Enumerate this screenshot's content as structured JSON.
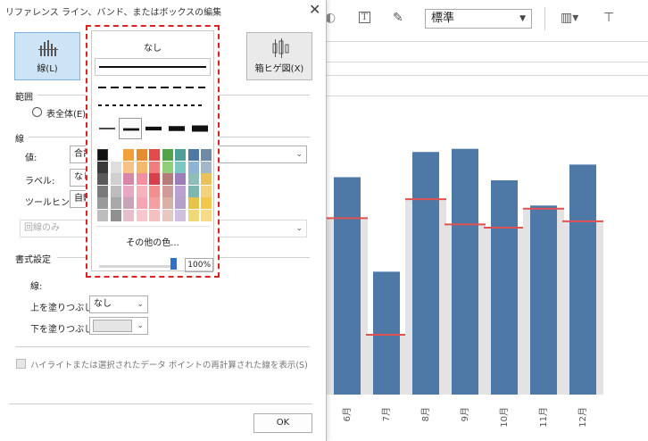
{
  "dialog": {
    "title": "リファレンス ライン、バンド、またはボックスの編集",
    "close_glyph": "✕",
    "type_buttons": [
      {
        "label": "線(L)",
        "selected": true
      },
      {
        "label": "箱ヒゲ図(X)",
        "selected": false
      }
    ],
    "range": {
      "section_title": "範囲",
      "option_label": "表全体(E)"
    },
    "line_section": {
      "title": "線",
      "value_label": "値:",
      "value_text": "合計",
      "label_label": "ラベル:",
      "label_value": "なし",
      "tooltip_label": "ツールヒント:",
      "tooltip_value": "自動",
      "line_only_text": "回線のみ"
    },
    "format_section": {
      "title": "書式設定",
      "line_label": "線:",
      "fill_above_label": "上を塗りつぶし:",
      "fill_above_value": "なし",
      "fill_below_label": "下を塗りつぶし:"
    },
    "highlight_checkbox_label": "ハイライトまたは選択されたデータ ポイントの再計算された線を表示(S)",
    "ok_label": "OK"
  },
  "popup": {
    "none_label": "なし",
    "more_colors_label": "その他の色...",
    "opacity_text": "100%",
    "opacity_percent": 100,
    "selected_weight_index": 1,
    "palette_columns": [
      [
        "#111111",
        "#3a3a3a",
        "#5a5a5a",
        "#7a7a7a",
        "#9a9a9a",
        "#bdbdbd"
      ],
      [
        "#ffffff",
        "#dedede",
        "#cfcfcf",
        "#bdbdbd",
        "#a8a8a8",
        "#909090"
      ],
      [
        "#f2a13a",
        "#f6c285",
        "#d987a6",
        "#e7a9c2",
        "#c9a4b8",
        "#e6bfcc"
      ],
      [
        "#e48d2c",
        "#f3b96b",
        "#f28fa1",
        "#f6b2bd",
        "#f4a6b4",
        "#f7c7cf"
      ],
      [
        "#e54a4a",
        "#f07d7d",
        "#d6404d",
        "#f28e8e",
        "#f4a0a0",
        "#f7c0c0"
      ],
      [
        "#55a24a",
        "#8fcf7c",
        "#b67b7b",
        "#cf9a9a",
        "#d9b0a6",
        "#e6c8c0"
      ],
      [
        "#4e9e9a",
        "#7cc7c2",
        "#9a7eb5",
        "#b9a2cf",
        "#b5a0c9",
        "#cfc0de"
      ],
      [
        "#4e79a7",
        "#8fb3d6",
        "#8cbfb8",
        "#7bb8b0",
        "#e6c44a",
        "#f0d77a"
      ],
      [
        "#6f8aa3",
        "#a4b7c9",
        "#e8c25a",
        "#f2d37c",
        "#f0c94a",
        "#f5dc85"
      ]
    ]
  },
  "toolbar": {
    "select_value": "標準",
    "icons": [
      "light-bulb-icon",
      "text-icon",
      "pin-icon",
      "chart-bars-icon",
      "presentation-icon"
    ]
  },
  "colors": {
    "bar": "#4e79a7",
    "band": "#e3e3e3",
    "reference_line": "#e05252",
    "selected_type": "#cde4f7",
    "popup_border": "#dd2222"
  },
  "chart_data": {
    "type": "bar",
    "categories": [
      "6月",
      "7月",
      "8月",
      "9月",
      "10月",
      "11月",
      "12月"
    ],
    "values": [
      69,
      39,
      77,
      78,
      68,
      60,
      73
    ],
    "reference_values": [
      56,
      19,
      62,
      54,
      53,
      59,
      55
    ],
    "band_values": [
      56,
      19,
      62,
      54,
      53,
      59,
      55
    ],
    "ylim": [
      0,
      85
    ],
    "grid": false,
    "xlabel": "",
    "ylabel": ""
  }
}
